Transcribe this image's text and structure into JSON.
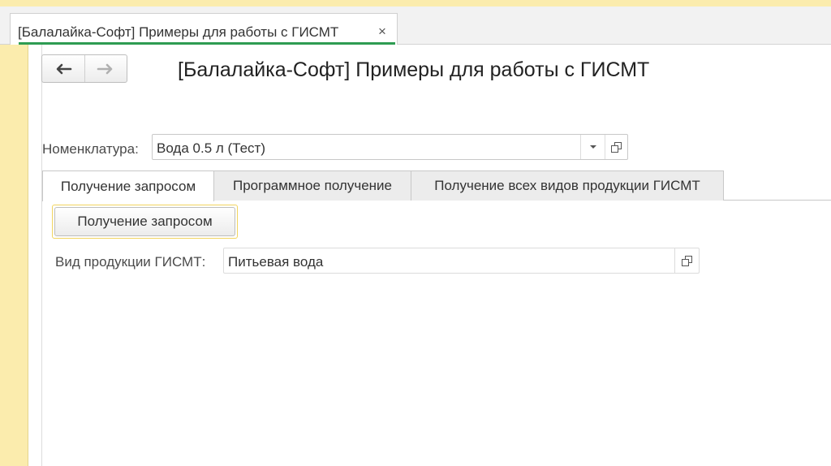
{
  "window_tab": {
    "title": "[Балалайка-Софт] Примеры для работы с ГИСМТ",
    "close_glyph": "×",
    "close_icon": "close-icon"
  },
  "nav": {
    "back_icon": "arrow-left-icon",
    "forward_icon": "arrow-right-icon"
  },
  "form": {
    "title": "[Балалайка-Софт] Примеры для работы с ГИСМТ",
    "nomenclature": {
      "label": "Номенклатура:",
      "value": "Вода 0.5 л (Тест)",
      "dropdown_icon": "chevron-down-icon",
      "open_icon": "open-in-window-icon"
    },
    "tabs": [
      {
        "label": "Получение запросом",
        "active": true
      },
      {
        "label": "Программное получение",
        "active": false
      },
      {
        "label": "Получение всех видов продукции ГИСМТ",
        "active": false
      }
    ],
    "request_button": "Получение запросом",
    "product_type": {
      "label": "Вид продукции ГИСМТ:",
      "value": "Питьевая вода",
      "open_icon": "open-in-window-icon"
    }
  },
  "colors": {
    "side_panel": "#fbecad",
    "active_tab_underline": "#2e9c52",
    "default_button_border": "#f1d45f"
  }
}
